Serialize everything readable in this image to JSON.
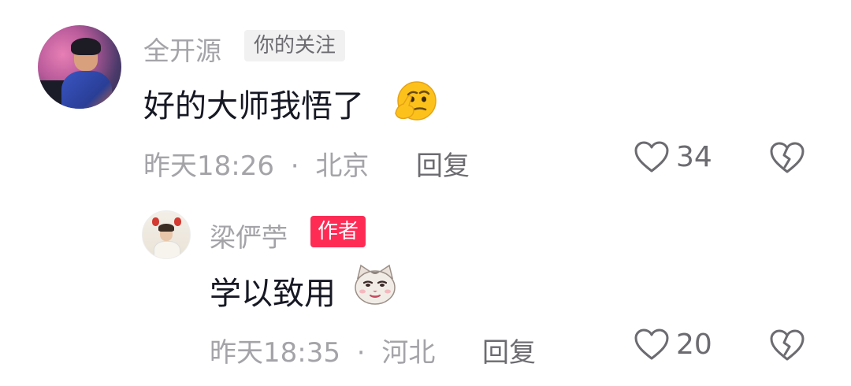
{
  "comments": [
    {
      "author": "全开源",
      "tag": "你的关注",
      "text": "好的大师我悟了",
      "emoji": "thinking-face-emoji",
      "time": "昨天18:26",
      "separator": "·",
      "location": "北京",
      "reply_label": "回复",
      "likes": "34"
    },
    {
      "author": "梁俨苧",
      "tag": "作者",
      "text": "学以致用",
      "emoji": "cat-face-emoji",
      "time": "昨天18:35",
      "separator": "·",
      "location": "河北",
      "reply_label": "回复",
      "likes": "20"
    }
  ],
  "colors": {
    "author_tag": "#fe2c55",
    "follow_tag_bg": "#f1f1f2",
    "meta_text": "#a4a4a8"
  }
}
